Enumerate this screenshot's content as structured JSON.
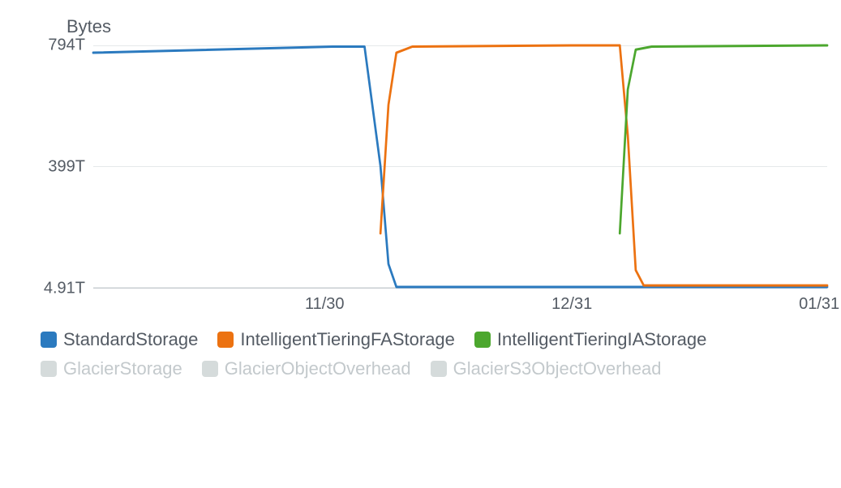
{
  "chart_data": {
    "type": "line",
    "title": "Bytes",
    "ylabel": "",
    "xlabel": "",
    "ylim": [
      4.91,
      794
    ],
    "y_unit_suffix": "T",
    "y_ticks": [
      {
        "value": 794,
        "label": "794T"
      },
      {
        "value": 399,
        "label": "399T"
      },
      {
        "value": 4.91,
        "label": "4.91T"
      }
    ],
    "x_domain": [
      0,
      92
    ],
    "x_ticks": [
      {
        "value": 29,
        "label": "11/30"
      },
      {
        "value": 60,
        "label": "12/31"
      },
      {
        "value": 91,
        "label": "01/31"
      }
    ],
    "series": [
      {
        "name": "StandardStorage",
        "color": "#2b7abf",
        "active": true,
        "x": [
          0,
          30,
          34,
          36,
          37,
          38,
          92
        ],
        "values": [
          770,
          790,
          790,
          400,
          80,
          5,
          5
        ]
      },
      {
        "name": "IntelligentTieringFAStorage",
        "color": "#ec7211",
        "active": true,
        "x": [
          36,
          37,
          38,
          40,
          60,
          66,
          67,
          68,
          69,
          92
        ],
        "values": [
          180,
          600,
          770,
          790,
          794,
          794,
          500,
          60,
          10,
          10
        ]
      },
      {
        "name": "IntelligentTieringIAStorage",
        "color": "#4ca72e",
        "active": true,
        "x": [
          66,
          67,
          68,
          70,
          92
        ],
        "values": [
          180,
          650,
          780,
          790,
          794
        ]
      },
      {
        "name": "GlacierStorage",
        "color": "#cccccc",
        "active": false,
        "x": [],
        "values": []
      },
      {
        "name": "GlacierObjectOverhead",
        "color": "#cccccc",
        "active": false,
        "x": [],
        "values": []
      },
      {
        "name": "GlacierS3ObjectOverhead",
        "color": "#cccccc",
        "active": false,
        "x": [],
        "values": []
      }
    ]
  }
}
